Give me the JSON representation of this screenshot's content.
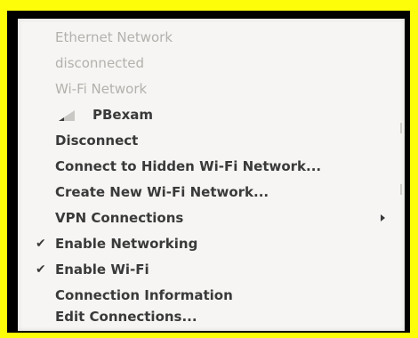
{
  "menu": {
    "headers": {
      "ethernet_network": "Ethernet Network",
      "ethernet_status": "disconnected",
      "wifi_network": "Wi-Fi Network"
    },
    "network": {
      "ssid": "PBexam",
      "icon": "wifi-signal-icon"
    },
    "items": {
      "disconnect": "Disconnect",
      "connect_hidden": "Connect to Hidden Wi-Fi Network...",
      "create_new": "Create New Wi-Fi Network...",
      "vpn_connections": "VPN Connections",
      "enable_networking": "Enable Networking",
      "enable_wifi": "Enable Wi-Fi",
      "connection_information": "Connection Information",
      "edit_connections": "Edit Connections..."
    },
    "check_glyph": "✔",
    "checked": {
      "enable_networking": true,
      "enable_wifi": true
    }
  }
}
